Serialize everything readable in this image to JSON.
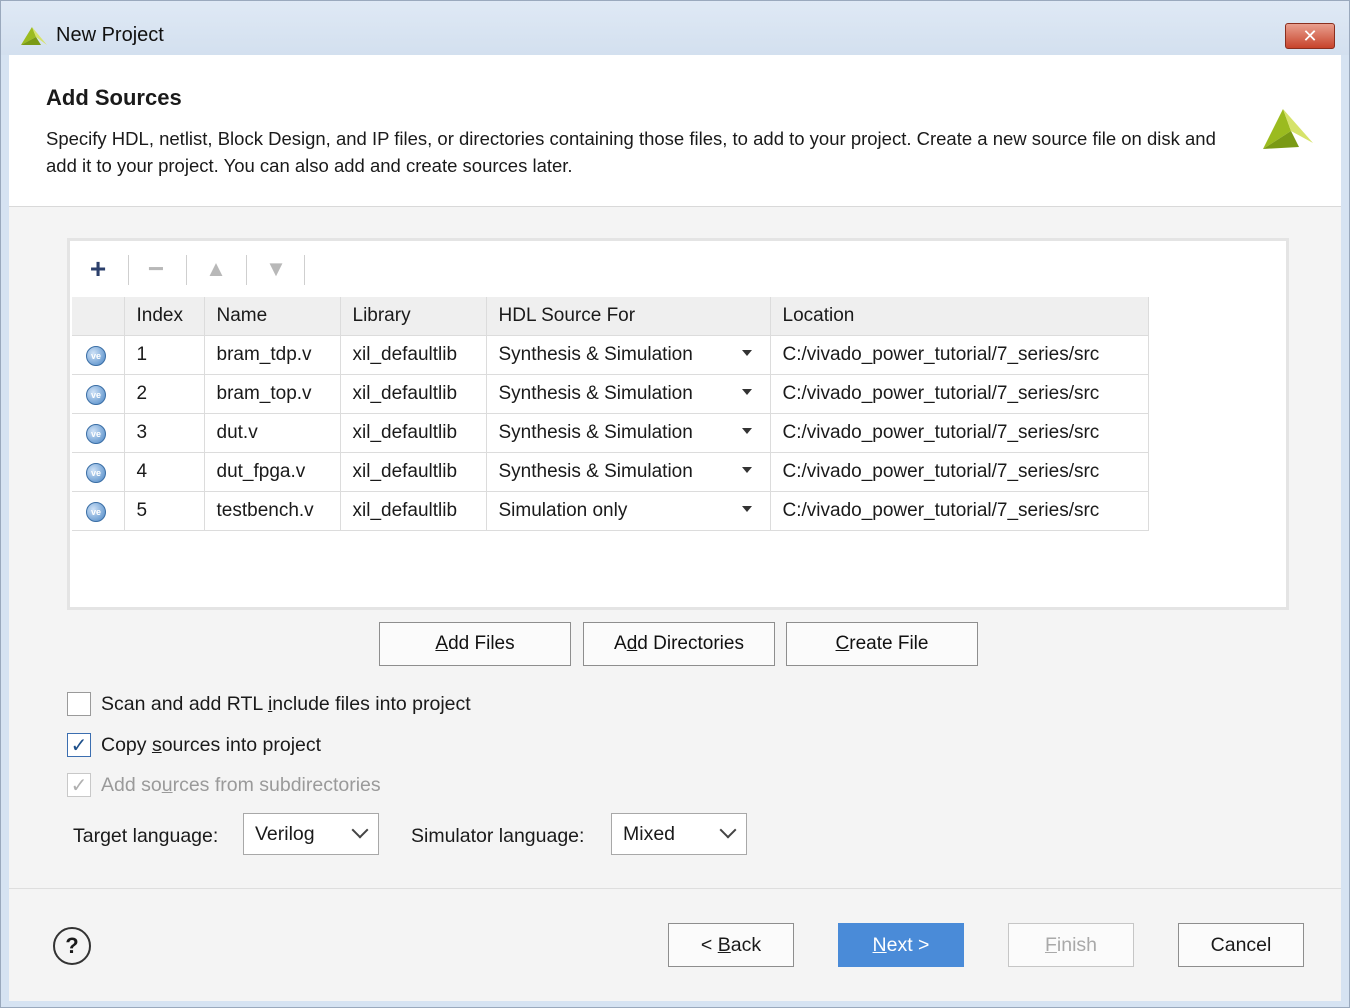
{
  "window": {
    "title": "New Project",
    "close_label": "✕"
  },
  "header": {
    "title": "Add Sources",
    "description": "Specify HDL, netlist, Block Design, and IP files, or directories containing those files, to add to your project. Create a new source file on disk and add it to your project. You can also add and create sources later."
  },
  "table": {
    "columns": [
      "",
      "Index",
      "Name",
      "Library",
      "HDL Source For",
      "Location"
    ],
    "rows": [
      {
        "icon": "ve",
        "index": "1",
        "name": "bram_tdp.v",
        "library": "xil_defaultlib",
        "hdl_source_for": "Synthesis & Simulation",
        "location": "C:/vivado_power_tutorial/7_series/src"
      },
      {
        "icon": "ve",
        "index": "2",
        "name": "bram_top.v",
        "library": "xil_defaultlib",
        "hdl_source_for": "Synthesis & Simulation",
        "location": "C:/vivado_power_tutorial/7_series/src"
      },
      {
        "icon": "ve",
        "index": "3",
        "name": "dut.v",
        "library": "xil_defaultlib",
        "hdl_source_for": "Synthesis & Simulation",
        "location": "C:/vivado_power_tutorial/7_series/src"
      },
      {
        "icon": "ve",
        "index": "4",
        "name": "dut_fpga.v",
        "library": "xil_defaultlib",
        "hdl_source_for": "Synthesis & Simulation",
        "location": "C:/vivado_power_tutorial/7_series/src"
      },
      {
        "icon": "ve",
        "index": "5",
        "name": "testbench.v",
        "library": "xil_defaultlib",
        "hdl_source_for": "Simulation only",
        "location": "C:/vivado_power_tutorial/7_series/src"
      }
    ]
  },
  "toolbar": {
    "add_icon": "plus-icon",
    "remove_icon": "minus-icon",
    "up_icon": "arrow-up-icon",
    "down_icon": "arrow-down-icon"
  },
  "actions": {
    "add_files": {
      "mnemonic": "A",
      "rest": "dd Files"
    },
    "add_directories": {
      "pre": "A",
      "mnemonic": "d",
      "rest": "d Directories"
    },
    "create_file": {
      "mnemonic": "C",
      "rest": "reate File"
    }
  },
  "options": {
    "scan_rtl": {
      "pre": "Scan and add RTL ",
      "mnemonic": "i",
      "rest": "nclude files into project",
      "checked": false
    },
    "copy_sources": {
      "pre": "Copy ",
      "mnemonic": "s",
      "rest": "ources into project",
      "checked": true
    },
    "add_subdirs": {
      "pre": "Add so",
      "mnemonic": "u",
      "rest": "rces from subdirectories",
      "checked": true,
      "disabled": true
    }
  },
  "languages": {
    "target_label": "Target language:",
    "target_value": "Verilog",
    "simulator_label": "Simulator language:",
    "simulator_value": "Mixed"
  },
  "footer": {
    "help": "?",
    "back": {
      "pre": "< ",
      "mnemonic": "B",
      "rest": "ack"
    },
    "next": {
      "mnemonic": "N",
      "rest": "ext >"
    },
    "finish": {
      "mnemonic": "F",
      "rest": "inish"
    },
    "cancel": "Cancel"
  },
  "colors": {
    "accent": "#4a8bd8",
    "title_bg": "#d6e3f2"
  }
}
